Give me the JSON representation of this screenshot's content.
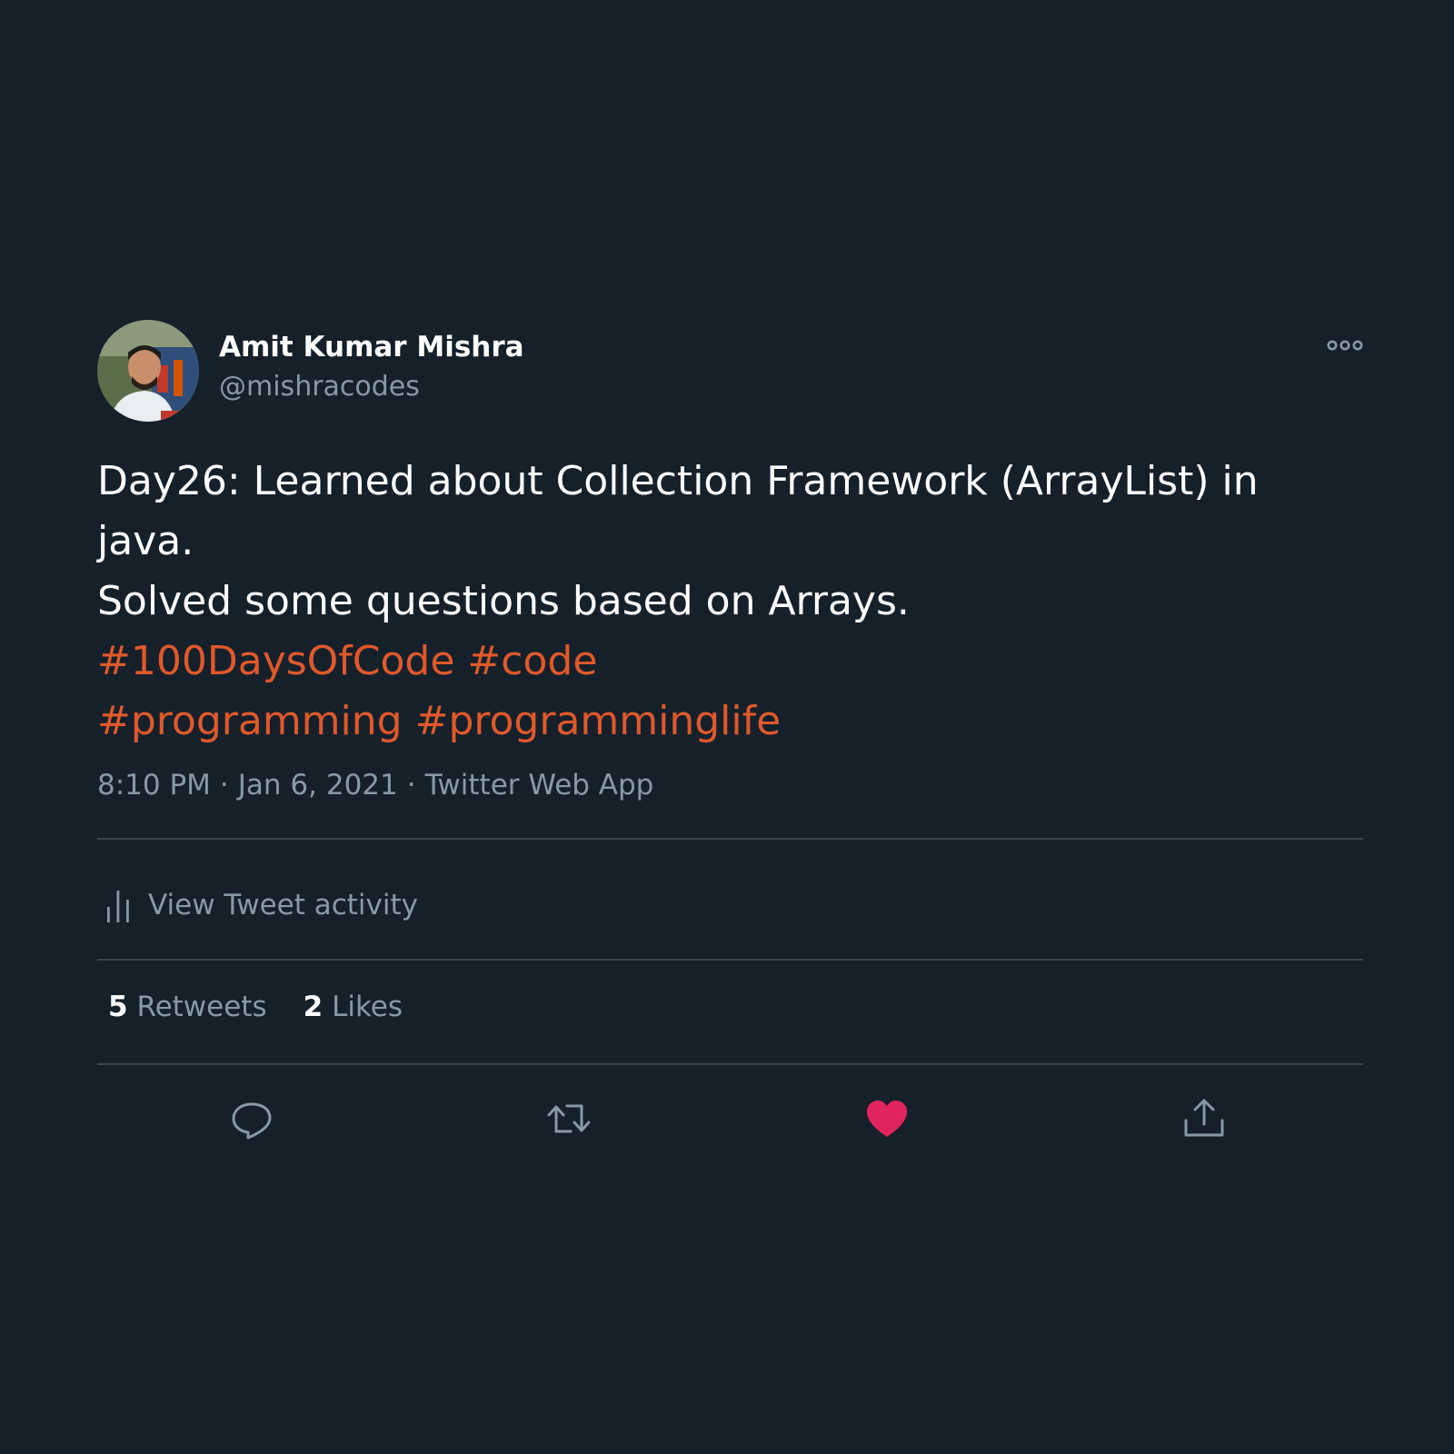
{
  "author": {
    "name": "Amit Kumar Mishra",
    "handle": "@mishracodes",
    "avatar_icon": "profile-photo"
  },
  "tweet": {
    "lines": [
      "Day26: Learned about Collection Framework (ArrayList) in",
      "java.",
      "Solved some questions based on Arrays."
    ],
    "hashtags_line1": [
      "#100DaysOfCode",
      "#code"
    ],
    "hashtags_line2": [
      "#programming",
      "#programminglife"
    ]
  },
  "meta": {
    "time": "8:10 PM",
    "date": "Jan 6, 2021",
    "separator": "·",
    "source": "Twitter Web App"
  },
  "activity": {
    "label": "View Tweet activity",
    "icon": "bar-chart-icon"
  },
  "stats": {
    "retweets_count": "5",
    "retweets_label": "Retweets",
    "likes_count": "2",
    "likes_label": "Likes"
  },
  "actions": {
    "icons": [
      "reply-icon",
      "retweet-icon",
      "like-icon",
      "share-icon"
    ],
    "liked": true
  },
  "colors": {
    "background": "#15202b",
    "text": "#ffffff",
    "secondary_text": "#8899a6",
    "hashtag": "#e0592a",
    "like_active": "#e0245e",
    "divider": "#38444d"
  }
}
